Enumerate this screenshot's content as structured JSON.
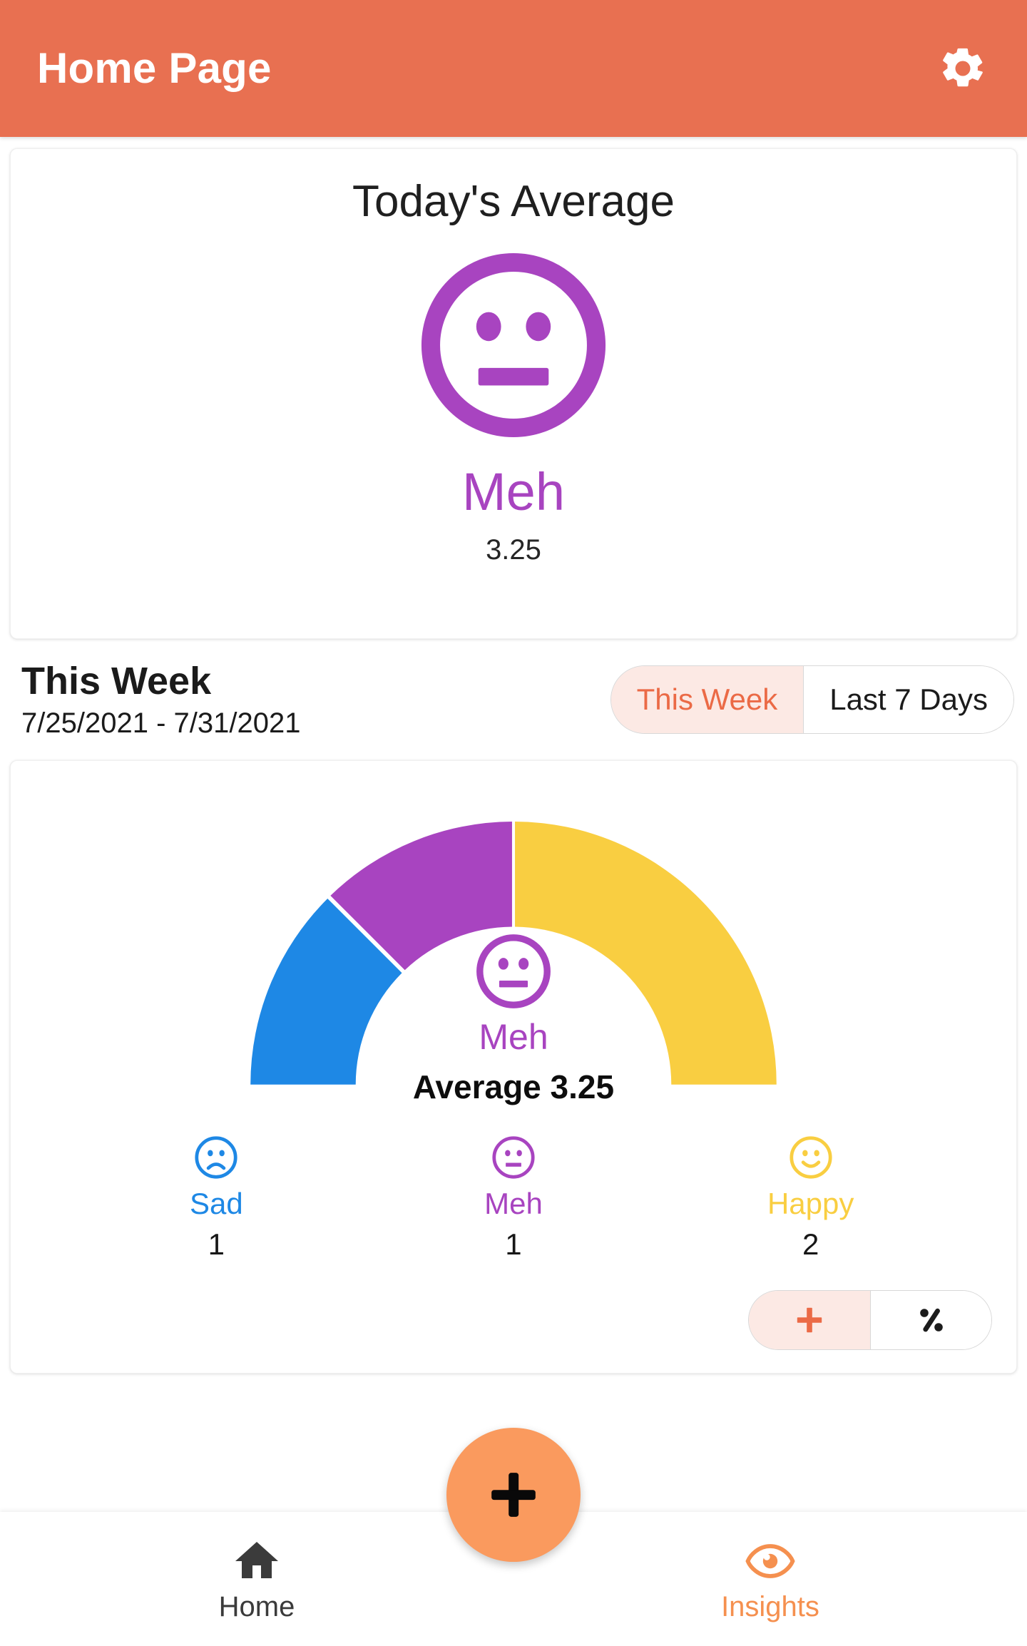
{
  "appbar": {
    "title": "Home Page",
    "settings_icon": "gear-icon"
  },
  "today_card": {
    "title": "Today's Average",
    "mood_label": "Meh",
    "mood_icon": "meh-face-icon",
    "score": "3.25",
    "mood_color": "#A844C0"
  },
  "week_header": {
    "title": "This Week",
    "date_range": "7/25/2021 - 7/31/2021",
    "segments": [
      {
        "label": "This Week",
        "selected": true
      },
      {
        "label": "Last 7 Days",
        "selected": false
      }
    ],
    "selected_color": "#EB6A46",
    "selected_bg": "#FCE9E4"
  },
  "week_chart": {
    "center_mood_label": "Meh",
    "center_mood_icon": "meh-face-icon",
    "average_text": "Average 3.25",
    "legend": [
      {
        "label": "Sad",
        "count": "1",
        "color": "#1E88E5",
        "icon": "sad-face-icon"
      },
      {
        "label": "Meh",
        "count": "1",
        "color": "#A844C0",
        "icon": "meh-face-icon"
      },
      {
        "label": "Happy",
        "count": "2",
        "color": "#F9CE41",
        "icon": "happy-face-icon"
      }
    ],
    "mode_toggle": [
      {
        "icon": "plus-icon",
        "selected": true
      },
      {
        "icon": "percent-icon",
        "selected": false
      }
    ]
  },
  "chart_data": {
    "type": "pie",
    "title": "This Week mood distribution",
    "subtitle": "7/25/2021 - 7/31/2021",
    "categories": [
      "Sad",
      "Meh",
      "Happy"
    ],
    "values": [
      1,
      1,
      2
    ],
    "colors": [
      "#1E88E5",
      "#A844C0",
      "#F9CE41"
    ],
    "total": 4,
    "average": 3.25,
    "average_label": "Average 3.25",
    "center_label": "Meh",
    "shape": "half-donut-gauge",
    "start_angle_deg": 180,
    "sweep_deg": 180,
    "segment_sweeps_deg": [
      45,
      45,
      90
    ],
    "legend": "below-chart",
    "grid": false
  },
  "bottom_nav": {
    "items": [
      {
        "label": "Home",
        "icon": "home-icon",
        "active": true
      },
      {
        "label": "Insights",
        "icon": "eye-icon",
        "active": false
      }
    ],
    "fab": {
      "icon": "plus-icon",
      "color": "#FA9A5E"
    }
  }
}
